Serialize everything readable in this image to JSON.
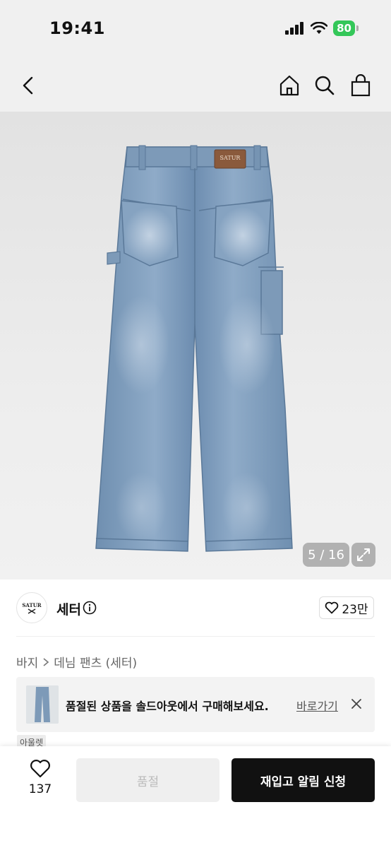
{
  "status_bar": {
    "time": "19:41",
    "battery": "80"
  },
  "nav": {
    "back_icon": "chevron-left-icon",
    "home_icon": "home-icon",
    "search_icon": "search-icon",
    "cart_icon": "shopping-bag-icon"
  },
  "gallery": {
    "current": 5,
    "total": 16,
    "counter_text": "5 / 16",
    "patch_text": "SATUR"
  },
  "brand": {
    "logo_text": "SATUR",
    "name": "세터",
    "likes": "23만"
  },
  "breadcrumb": {
    "category": "바지",
    "subcategory": "데님 팬츠 (세터)"
  },
  "soldout_banner": {
    "message": "품절된 상품을 솔드아웃에서 구매해보세요.",
    "link": "바로가기"
  },
  "outlet_tag": "아울렛",
  "bottom_bar": {
    "wish_count": "137",
    "soldout_label": "품절",
    "restock_label": "재입고 알림 신청"
  },
  "colors": {
    "accent": "#111111",
    "battery": "#34c759",
    "denim": "#7d9ab8"
  }
}
